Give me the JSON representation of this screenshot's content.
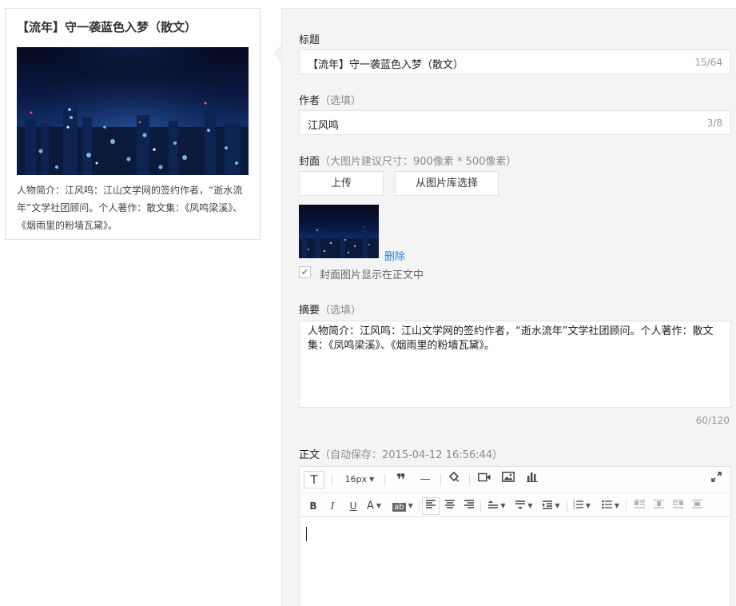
{
  "preview": {
    "title": "【流年】守一袭蓝色入梦（散文）",
    "summary": "人物简介：江风鸣：江山文学网的签约作者，“逝水流年”文学社团顾问。个人著作：散文集：《凤鸣梁溪》、《烟雨里的粉墙瓦黛》。"
  },
  "form": {
    "title_label": "标题",
    "title_value": "【流年】守一袭蓝色入梦（散文）",
    "title_count": "15/64",
    "author_label": "作者",
    "author_optional": "（选填）",
    "author_value": "江风鸣",
    "author_count": "3/8",
    "cover_label": "封面",
    "cover_hint": "（大图片建议尺寸：900像素 * 500像素）",
    "upload_button": "上传",
    "library_button": "从图片库选择",
    "delete_link": "删除",
    "show_in_body_label": "封面图片显示在正文中",
    "summary_label": "摘要",
    "summary_optional": "（选填）",
    "summary_value": "人物简介：江风鸣：江山文学网的签约作者，“逝水流年”文学社团顾问。个人著作：散文集：《凤鸣梁溪》、《烟雨里的粉墙瓦黛》。",
    "summary_count": "60/120",
    "body_label": "正文",
    "body_autosave": "（自动保存：2015-04-12 16:56:44）"
  },
  "toolbar": {
    "font_size": "16px"
  },
  "colors": {
    "panel_bg": "#f4f4f4",
    "link": "#2a83d6",
    "border": "#e1e1e1"
  }
}
